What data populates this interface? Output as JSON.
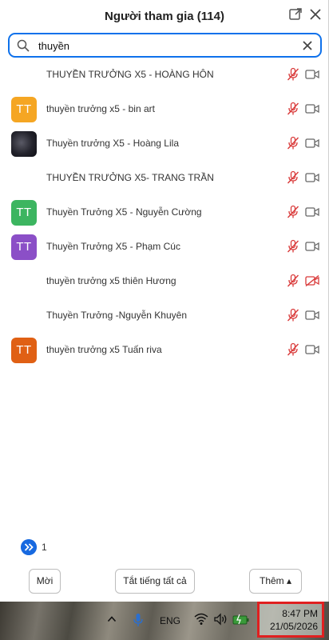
{
  "header": {
    "title": "Người tham gia (114)"
  },
  "search": {
    "value": "thuyền",
    "placeholder": ""
  },
  "participants": [
    {
      "name": "THUYỀN TRƯỞNG X5 - HOÀNG HÔN",
      "avatar_type": "none",
      "avatar_text": "",
      "avatar_color": "",
      "mic": "muted",
      "video": "off"
    },
    {
      "name": "thuyền trưởng x5 - bin art",
      "avatar_type": "initials",
      "avatar_text": "TT",
      "avatar_color": "#f5a623",
      "mic": "muted",
      "video": "off"
    },
    {
      "name": "Thuyền trưởng X5 - Hoàng Lila",
      "avatar_type": "photo",
      "avatar_text": "",
      "avatar_color": "",
      "mic": "muted",
      "video": "off"
    },
    {
      "name": "THUYỀN TRƯỞNG X5- TRANG TRẦN",
      "avatar_type": "none",
      "avatar_text": "",
      "avatar_color": "",
      "mic": "muted",
      "video": "off"
    },
    {
      "name": "Thuyền Trưởng X5 - Nguyễn Cường",
      "avatar_type": "initials",
      "avatar_text": "TT",
      "avatar_color": "#3cb560",
      "mic": "muted",
      "video": "off"
    },
    {
      "name": "Thuyền Trưởng X5 - Phạm Cúc",
      "avatar_type": "initials",
      "avatar_text": "TT",
      "avatar_color": "#8b4fc7",
      "mic": "muted",
      "video": "off"
    },
    {
      "name": "thuyền trưởng x5 thiên Hương",
      "avatar_type": "none",
      "avatar_text": "",
      "avatar_color": "",
      "mic": "muted",
      "video": "blocked"
    },
    {
      "name": "Thuyền Trưởng -Nguyễn Khuyên",
      "avatar_type": "none",
      "avatar_text": "",
      "avatar_color": "",
      "mic": "muted",
      "video": "off"
    },
    {
      "name": "thuyền trưởng x5 Tuấn riva",
      "avatar_type": "initials",
      "avatar_text": "TT",
      "avatar_color": "#e06014",
      "mic": "muted",
      "video": "off"
    }
  ],
  "pager": {
    "page": "1"
  },
  "footer": {
    "invite_label": "Mời",
    "mute_all_label": "Tắt tiếng tất cả",
    "more_label": "Thêm ▴"
  },
  "taskbar": {
    "language": "ENG",
    "time": "8:47 PM",
    "date": "21/05/2026"
  },
  "colors": {
    "accent": "#0e71eb",
    "muted_red": "#d93a3a",
    "highlight_box": "#e02020"
  },
  "icons": {
    "header": [
      "popout-icon",
      "close-icon"
    ],
    "search": [
      "search-icon",
      "clear-icon"
    ],
    "row": [
      "mic-muted-icon",
      "video-off-icon"
    ],
    "taskbar": [
      "chevron-up-icon",
      "microphone-icon",
      "wifi-icon",
      "volume-icon",
      "battery-icon"
    ]
  }
}
